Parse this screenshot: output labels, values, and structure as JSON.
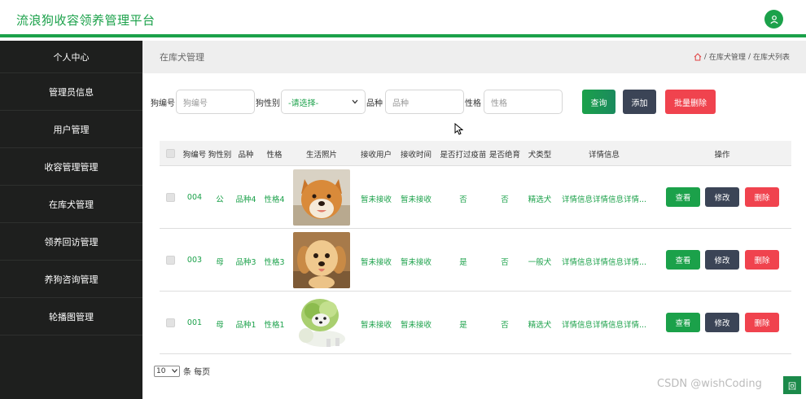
{
  "app": {
    "title": "流浪狗收容领养管理平台"
  },
  "sidebar": {
    "items": [
      {
        "label": "个人中心"
      },
      {
        "label": "管理员信息"
      },
      {
        "label": "用户管理"
      },
      {
        "label": "收容管理管理"
      },
      {
        "label": "在库犬管理"
      },
      {
        "label": "领养回访管理"
      },
      {
        "label": "养狗咨询管理"
      },
      {
        "label": "轮播图管理"
      }
    ]
  },
  "header": {
    "page_title": "在库犬管理",
    "breadcrumb": [
      "在库犬管理",
      "在库犬列表"
    ],
    "separator": "/"
  },
  "search": {
    "dog_no_label": "狗编号",
    "dog_no_placeholder": "狗编号",
    "gender_label": "狗性别",
    "gender_selected": "-请选择-",
    "breed_label": "品种",
    "breed_placeholder": "品种",
    "temper_label": "性格",
    "temper_placeholder": "性格",
    "query_label": "查询",
    "add_label": "添加",
    "batch_delete_label": "批量删除"
  },
  "table": {
    "columns": [
      "狗编号",
      "狗性别",
      "品种",
      "性格",
      "生活照片",
      "接收用户",
      "接收时间",
      "是否打过疫苗",
      "是否绝育",
      "犬类型",
      "详情信息",
      "操作"
    ],
    "rows": [
      {
        "no": "004",
        "gender": "公",
        "breed": "品种4",
        "temper": "性格4",
        "photo": "shiba-inu",
        "user": "暂未接收",
        "time": "暂未接收",
        "vaccinated": "否",
        "neutered": "否",
        "type": "精选犬",
        "detail": "详情信息详情信息详情..."
      },
      {
        "no": "003",
        "gender": "母",
        "breed": "品种3",
        "temper": "性格3",
        "photo": "golden-puppy",
        "user": "暂未接收",
        "time": "暂未接收",
        "vaccinated": "是",
        "neutered": "否",
        "type": "一般犬",
        "detail": "详情信息详情信息详情..."
      },
      {
        "no": "001",
        "gender": "母",
        "breed": "品种1",
        "temper": "性格1",
        "photo": "cabbage-dog",
        "user": "暂未接收",
        "time": "暂未接收",
        "vaccinated": "是",
        "neutered": "否",
        "type": "精选犬",
        "detail": "详情信息详情信息详情..."
      }
    ],
    "actions": {
      "view": "查看",
      "edit": "修改",
      "delete": "删除"
    }
  },
  "pager": {
    "page_size": "10",
    "per_page_label": "条 每页"
  },
  "watermark": "CSDN @wishCoding",
  "corner_glyph": "回",
  "colors": {
    "brand": "#1ba14a",
    "sidebar_bg": "#1e1f1e",
    "edit": "#3b4456",
    "delete": "#f0434e",
    "view": "#1ba14a"
  }
}
